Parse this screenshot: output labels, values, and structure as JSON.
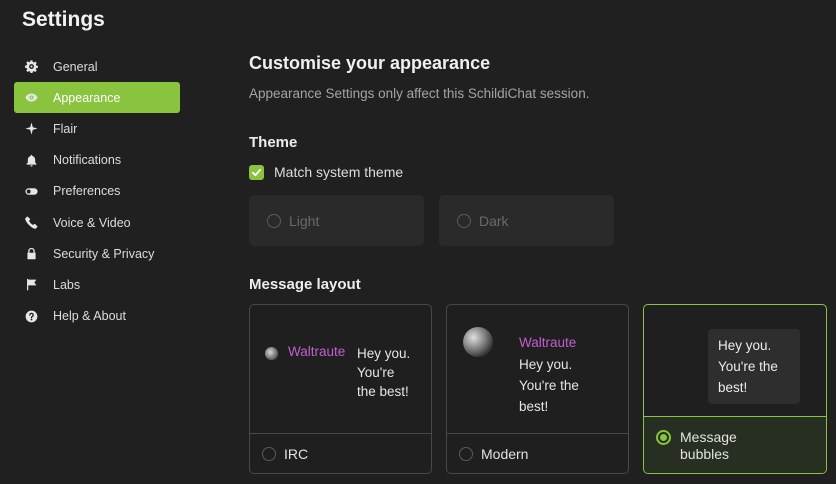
{
  "window": {
    "title": "Settings"
  },
  "sidebar": {
    "items": [
      {
        "label": "General",
        "icon": "gear-icon"
      },
      {
        "label": "Appearance",
        "icon": "eye-icon",
        "active": true
      },
      {
        "label": "Flair",
        "icon": "sparkle-icon"
      },
      {
        "label": "Notifications",
        "icon": "bell-icon"
      },
      {
        "label": "Preferences",
        "icon": "toggle-icon"
      },
      {
        "label": "Voice & Video",
        "icon": "phone-icon"
      },
      {
        "label": "Security & Privacy",
        "icon": "lock-icon"
      },
      {
        "label": "Labs",
        "icon": "flag-icon"
      },
      {
        "label": "Help & About",
        "icon": "help-icon"
      }
    ]
  },
  "main": {
    "title": "Customise your appearance",
    "subtitle": "Appearance Settings only affect this SchildiChat session.",
    "theme": {
      "heading": "Theme",
      "match_system_label": "Match system theme",
      "match_system_checked": true,
      "options": [
        "Light",
        "Dark"
      ]
    },
    "layout": {
      "heading": "Message layout",
      "preview": {
        "sender": "Waltraute",
        "line1": "Hey you.",
        "line2": "You're the",
        "line3": "best!",
        "line2_irc": "You're",
        "line3_irc": "the best!",
        "line1_bubble": "Hey you.",
        "line2_bubble": "You're the",
        "line3_bubble": "best!"
      },
      "options": [
        {
          "label": "IRC",
          "selected": false
        },
        {
          "label": "Modern",
          "selected": false
        },
        {
          "label_line1": "Message",
          "label_line2": "bubbles",
          "selected": true
        }
      ]
    }
  },
  "colors": {
    "accent": "#8ac43f",
    "background": "#202020",
    "sender": "#c15fcf"
  }
}
